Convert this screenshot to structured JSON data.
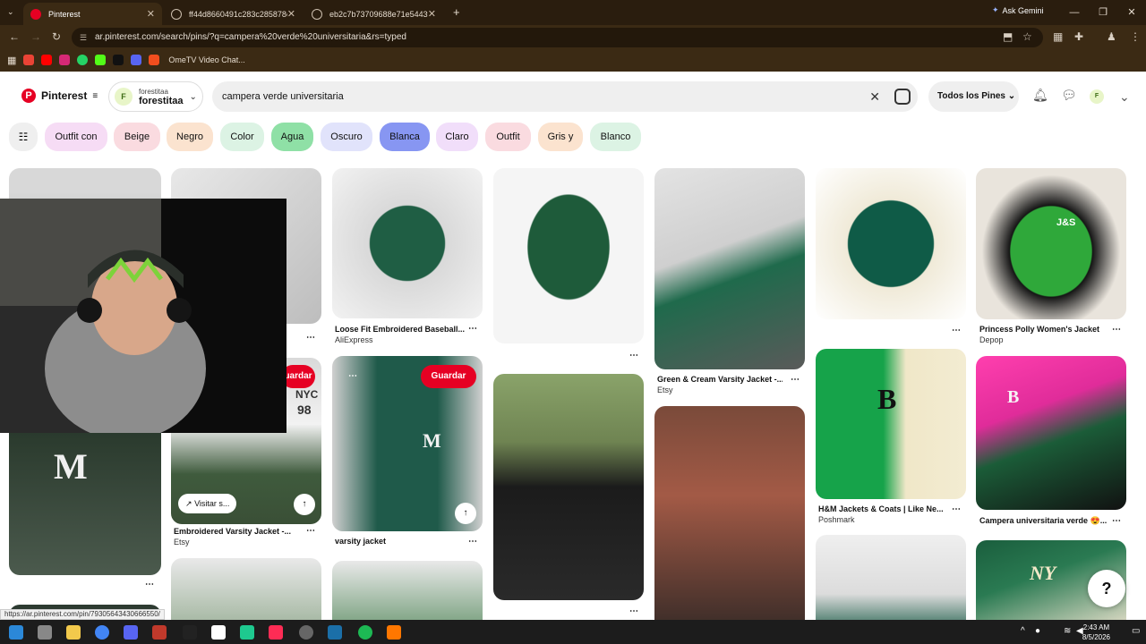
{
  "browser": {
    "tabs": [
      {
        "label": "Pinterest",
        "color": "#e60023"
      },
      {
        "label": "ff44d8660491c283c285878ee16...",
        "color": "#888888"
      },
      {
        "label": "eb2c7b73709688e71e5443f24...",
        "color": "#888888"
      }
    ],
    "ask_gemini": "Ask Gemini",
    "url": "ar.pinterest.com/search/pins/?q=campera%20verde%20universitaria&rs=typed",
    "bookmark_label": "OmeTV Video Chat..."
  },
  "pinterest": {
    "logo_text": "Pinterest",
    "account_small": "forestitaa",
    "account_name": "forestitaa",
    "avatar_letter": "F",
    "search_value": "campera verde universitaria",
    "filter_label": "Todos los Pines",
    "chips": [
      {
        "label": "Outfit con",
        "bg": "#f6dcf5"
      },
      {
        "label": "Beige",
        "bg": "#fadbe0"
      },
      {
        "label": "Negro",
        "bg": "#fbe3cf"
      },
      {
        "label": "Color",
        "bg": "#dcf3e4"
      },
      {
        "label": "Agua",
        "bg": "#8fe0a6"
      },
      {
        "label": "Oscuro",
        "bg": "#e1e3fb"
      },
      {
        "label": "Blanca",
        "bg": "#8796f2"
      },
      {
        "label": "Claro",
        "bg": "#f1defa"
      },
      {
        "label": "Outfit",
        "bg": "#fadbe0"
      },
      {
        "label": "Gris y",
        "bg": "#fbe3cf"
      },
      {
        "label": "Blanco",
        "bg": "#dcf3e4"
      }
    ],
    "pins": {
      "p3": {
        "title": "Loose Fit Embroidered Baseball...",
        "source": "AliExpress"
      },
      "p5": {
        "title": "Green & Cream Varsity Jacket -...",
        "source": "Etsy"
      },
      "p7": {
        "title": "Princess Polly Women's Jacket",
        "source": "Depop"
      },
      "p9": {
        "title": "Embroidered Varsity Jacket -...",
        "source": "Etsy"
      },
      "p10": {
        "title": "varsity jacket",
        "source": ""
      },
      "p13": {
        "title": "H&M Jackets & Coats | Like Ne...",
        "source": "Poshmark"
      },
      "p14": {
        "title": "Campera universitaria verde 😍...",
        "source": ""
      }
    },
    "save_label": "Guardar",
    "save_label_partial": "uardar",
    "visit_label": "Visitar s...",
    "more_icon": "⋯",
    "share_icon": "↑",
    "overlay_texts": [
      "NYC",
      "98",
      "M",
      "B",
      "NY",
      "J&S"
    ],
    "help_icon": "?"
  },
  "status_url": "https://ar.pinterest.com/pin/79305643430666550/",
  "taskbar": {
    "time": "2:43 AM",
    "date": "8/5/2026"
  }
}
